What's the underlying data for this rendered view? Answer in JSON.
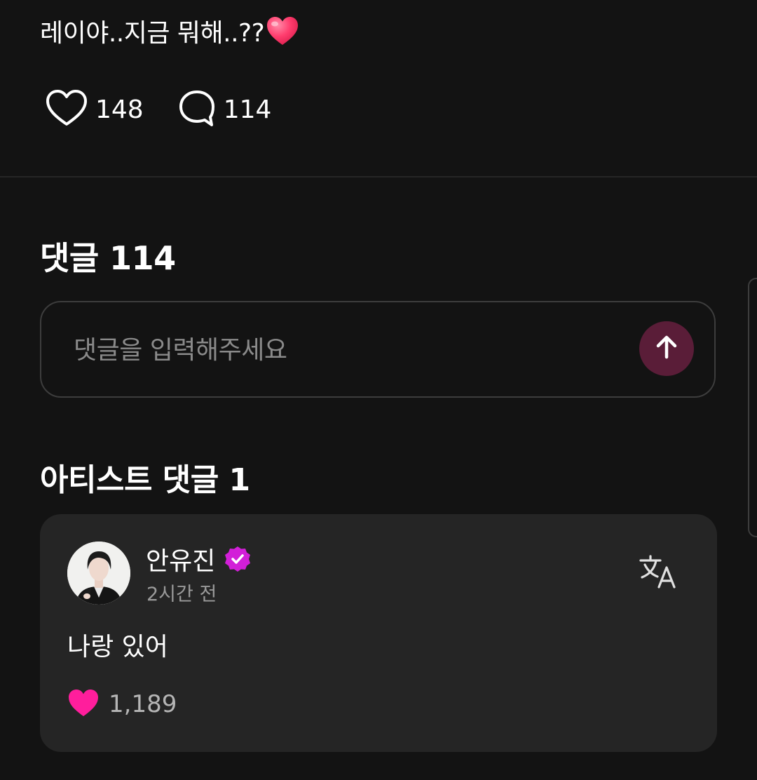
{
  "post": {
    "text": "레이야..지금 뭐해..??",
    "emoji_icon": "red-heart-emoji"
  },
  "actions": {
    "like_icon": "heart-outline-icon",
    "like_count": "148",
    "comment_icon": "speech-bubble-icon",
    "comment_count": "114"
  },
  "comments_section": {
    "title": "댓글 114",
    "input_placeholder": "댓글을 입력해주세요",
    "input_value": "",
    "send_icon": "arrow-up-icon"
  },
  "artist_comments": {
    "title": "아티스트 댓글 1",
    "comment": {
      "author": "안유진",
      "verified_icon": "verified-badge-icon",
      "time": "2시간 전",
      "translate_icon": "translate-icon",
      "body": "나랑 있어",
      "like_icon": "heart-filled-icon",
      "like_count": "1,189"
    }
  },
  "colors": {
    "background": "#131313",
    "card": "#252525",
    "accent_pink": "#ff1e9c",
    "send_button": "#5a1d38",
    "verified_badge": "#d21fd8"
  }
}
